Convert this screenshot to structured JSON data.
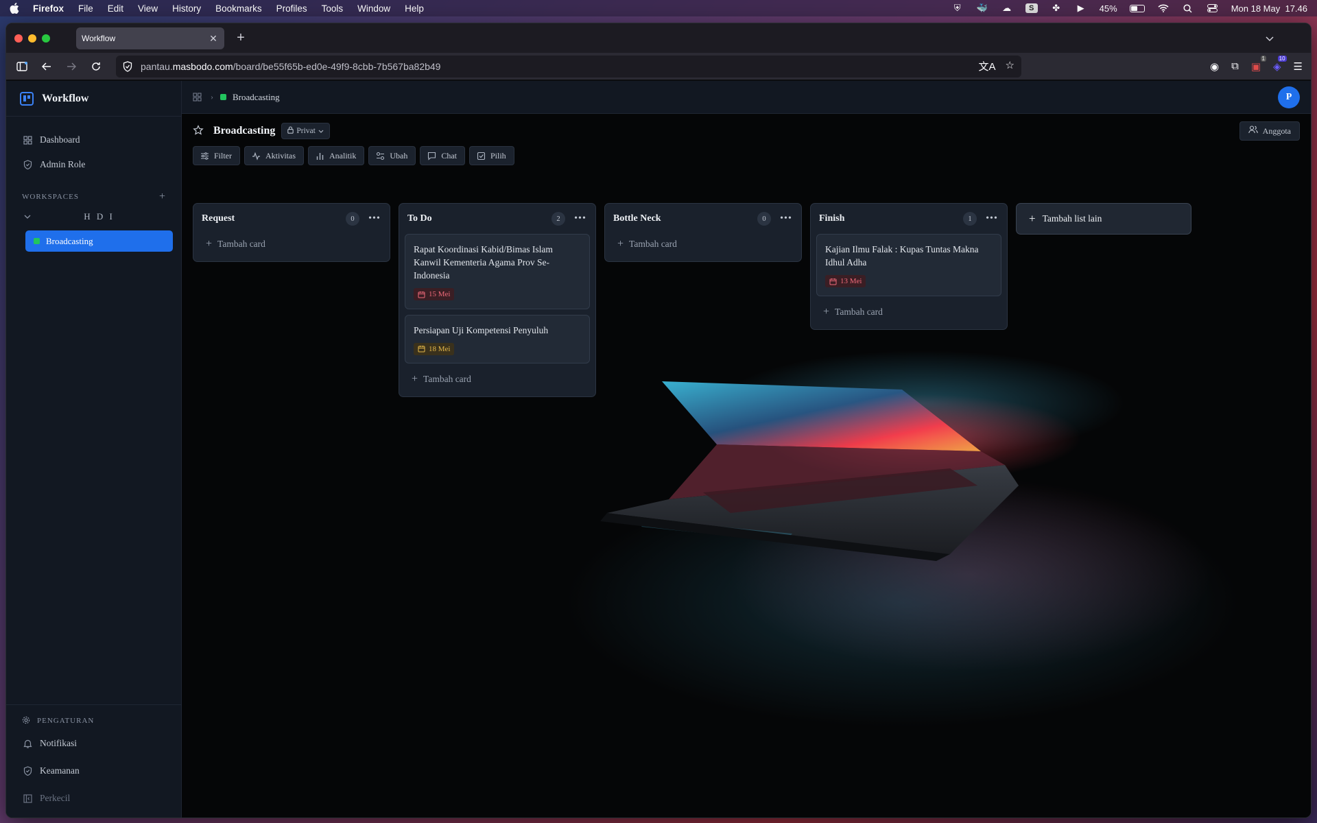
{
  "os_menubar": {
    "app_name": "Firefox",
    "menus": [
      "File",
      "Edit",
      "View",
      "History",
      "Bookmarks",
      "Profiles",
      "Tools",
      "Window",
      "Help"
    ],
    "battery": "45%",
    "clock": "Mon 18 May  17.46"
  },
  "browser": {
    "tab_title": "Workflow",
    "url_prefix": "pantau.",
    "url_host": "masbodo.com",
    "url_path": "/board/be55f65b-ed0e-49f9-8cbb-7b567ba82b49",
    "ext_badge_1": "1",
    "ext_badge_2": "10"
  },
  "sidebar": {
    "brand": "Workflow",
    "nav": [
      {
        "label": "Dashboard",
        "icon": "grid-icon"
      },
      {
        "label": "Admin Role",
        "icon": "shield-icon"
      }
    ],
    "workspaces_label": "WORKSPACES",
    "workspace_group": "H D I",
    "active_board": "Broadcasting",
    "settings_label": "PENGATURAN",
    "settings_items": [
      {
        "label": "Notifikasi",
        "icon": "bell-icon"
      },
      {
        "label": "Keamanan",
        "icon": "shield-icon"
      },
      {
        "label": "Perkecil",
        "icon": "collapse-icon"
      }
    ]
  },
  "topbar": {
    "breadcrumb": "Broadcasting",
    "avatar_initial": "P"
  },
  "board": {
    "title": "Broadcasting",
    "visibility": "Privat",
    "members_button": "Anggota",
    "toolbar": [
      "Filter",
      "Aktivitas",
      "Analitik",
      "Ubah",
      "Chat",
      "Pilih"
    ]
  },
  "lists": [
    {
      "title": "Request",
      "count": "0",
      "cards": [],
      "add_label": "Tambah card"
    },
    {
      "title": "To Do",
      "count": "2",
      "cards": [
        {
          "title": "Rapat Koordinasi Kabid/Bimas Islam Kanwil Kementeria Agama Prov Se-Indonesia",
          "due": "15 Mei",
          "due_color": "#f06a7a"
        },
        {
          "title": "Persiapan Uji Kompetensi Penyuluh",
          "due": "18 Mei",
          "due_color": "#e5b94a"
        }
      ],
      "add_label": "Tambah card"
    },
    {
      "title": "Bottle Neck",
      "count": "0",
      "cards": [],
      "add_label": "Tambah card"
    },
    {
      "title": "Finish",
      "count": "1",
      "cards": [
        {
          "title": "Kajian Ilmu Falak : Kupas Tuntas Makna Idhul Adha",
          "due": "13 Mei",
          "due_color": "#f06a7a"
        }
      ],
      "add_label": "Tambah card"
    }
  ],
  "add_list_label": "Tambah list lain",
  "colors": {
    "accent": "#1f6feb",
    "board_dot": "#22c55e"
  }
}
